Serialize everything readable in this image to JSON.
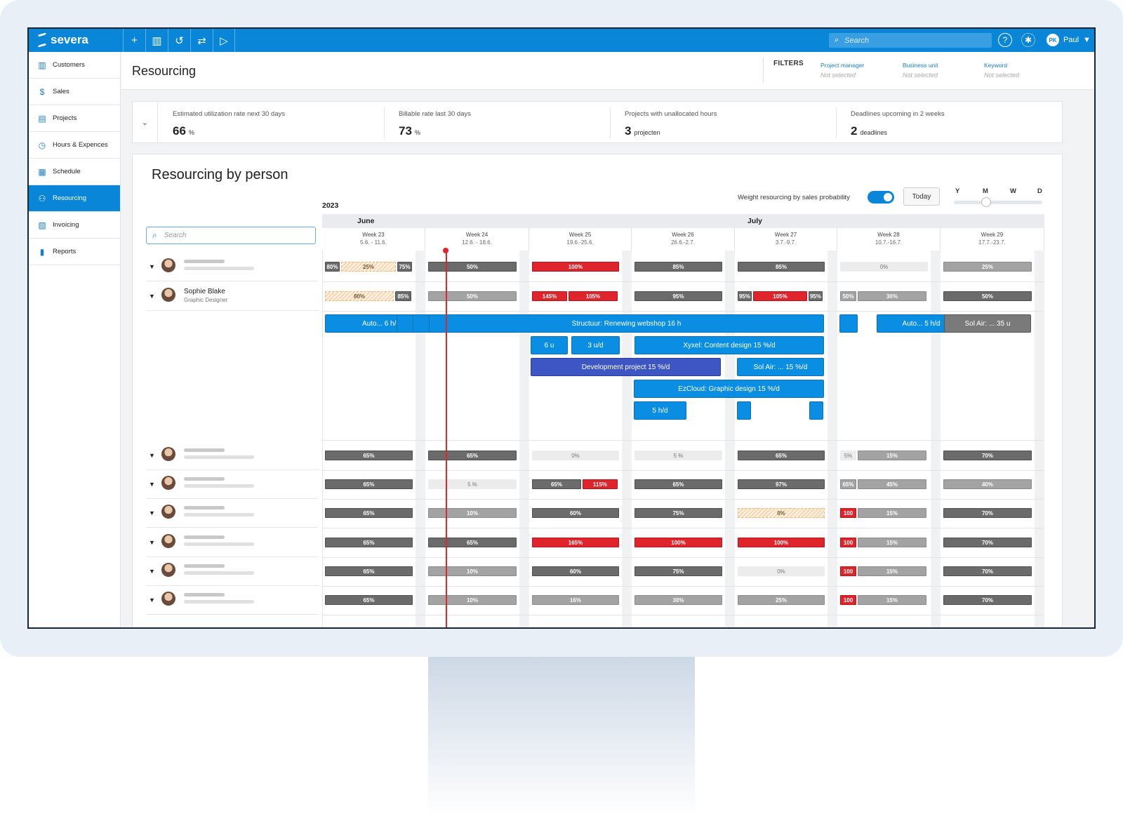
{
  "app": {
    "logo": "severa",
    "search_placeholder": "Search",
    "user_initials": "PK",
    "user_name": "Paul"
  },
  "toolbar_icons": [
    "plus-icon",
    "chart-icon",
    "history-icon",
    "swap-icon",
    "play-icon"
  ],
  "sidebar": {
    "items": [
      {
        "label": "Customers",
        "icon": "building-icon",
        "active": false
      },
      {
        "label": "Sales",
        "icon": "dollar-icon",
        "active": false
      },
      {
        "label": "Projects",
        "icon": "folder-icon",
        "active": false
      },
      {
        "label": "Hours & Expences",
        "icon": "clock-icon",
        "active": false
      },
      {
        "label": "Schedule",
        "icon": "calendar-icon",
        "active": false
      },
      {
        "label": "Resourcing",
        "icon": "people-icon",
        "active": true
      },
      {
        "label": "Invoicing",
        "icon": "invoice-icon",
        "active": false
      },
      {
        "label": "Reports",
        "icon": "bar-chart-icon",
        "active": false
      }
    ]
  },
  "header": {
    "title": "Resourcing",
    "filters_label": "FILTERS",
    "filters": [
      {
        "label": "Project manager",
        "value": "Not selected"
      },
      {
        "label": "Business unit",
        "value": "Not selected"
      },
      {
        "label": "Keyword",
        "value": "Not selected"
      }
    ]
  },
  "kpis": [
    {
      "label": "Estimated utilization rate next 30 days",
      "value": "66",
      "unit": "%"
    },
    {
      "label": "Billable rate last 30 days",
      "value": "73",
      "unit": "%"
    },
    {
      "label": "Projects with unallocated hours",
      "value": "3",
      "unit": "projecten"
    },
    {
      "label": "Deadlines upcoming in 2 weeks",
      "value": "2",
      "unit": "deadlines"
    }
  ],
  "section": {
    "title": "Resourcing by person",
    "weight_label": "Weight resourcing by sales probability",
    "weight_on": true,
    "today_label": "Today",
    "zoom_labels": [
      "Y",
      "M",
      "W",
      "D"
    ],
    "zoom_selected": "M",
    "year": "2023",
    "search_placeholder": "Search"
  },
  "months": [
    {
      "label": "June"
    },
    {
      "label": "July"
    }
  ],
  "weeks": [
    {
      "label": "Week 23",
      "dates": "5.6. - 11.6."
    },
    {
      "label": "Week 24",
      "dates": "12.6. - 18.6."
    },
    {
      "label": "Week 25",
      "dates": "19.6.-25.6."
    },
    {
      "label": "Week 26",
      "dates": "26.6.-2.7."
    },
    {
      "label": "Week 27",
      "dates": "3.7.-9.7."
    },
    {
      "label": "Week 28",
      "dates": "10.7.-16.7."
    },
    {
      "label": "Week 29",
      "dates": "17.7.-23.7."
    }
  ],
  "people": [
    {
      "name": "",
      "role": "",
      "placeholder": true,
      "weeks": [
        [
          [
            "80%",
            "dark",
            0.18
          ],
          [
            "25%",
            "striped",
            0.64
          ],
          [
            "75%",
            "dark",
            0.18
          ]
        ],
        [
          [
            "50%",
            "dark",
            1
          ]
        ],
        [
          [
            "100%",
            "red",
            1
          ]
        ],
        [
          [
            "85%",
            "dark",
            1
          ]
        ],
        [
          [
            "85%",
            "dark",
            1
          ]
        ],
        [
          [
            "0%",
            "empty",
            1
          ]
        ],
        [
          [
            "25%",
            "mid",
            1
          ]
        ]
      ]
    },
    {
      "name": "Sophie Blake",
      "role": "Graphic Designer",
      "placeholder": false,
      "weeks": [
        [
          [
            "80%",
            "striped",
            0.8
          ],
          [
            "85%",
            "dark",
            0.2
          ]
        ],
        [
          [
            "50%",
            "mid",
            1
          ]
        ],
        [
          [
            "145%",
            "red",
            0.42
          ],
          [
            "105%",
            "red",
            0.58
          ]
        ],
        [
          [
            "95%",
            "dark",
            1
          ]
        ],
        [
          [
            "95%",
            "dark",
            0.18
          ],
          [
            "105%",
            "red",
            0.64
          ],
          [
            "95%",
            "dark",
            0.18
          ]
        ],
        [
          [
            "50%",
            "mid",
            0.2
          ],
          [
            "30%",
            "mid",
            0.8
          ]
        ],
        [
          [
            "50%",
            "dark",
            1
          ]
        ]
      ]
    },
    {
      "name": "",
      "role": "",
      "placeholder": true,
      "weeks": [
        [
          [
            "65%",
            "dark",
            1
          ]
        ],
        [
          [
            "65%",
            "dark",
            1
          ]
        ],
        [
          [
            "0%",
            "empty",
            1
          ]
        ],
        [
          [
            "5 %",
            "empty",
            1
          ]
        ],
        [
          [
            "65%",
            "dark",
            1
          ]
        ],
        [
          [
            "5%",
            "empty",
            0.2
          ],
          [
            "15%",
            "mid",
            0.8
          ]
        ],
        [
          [
            "70%",
            "dark",
            1
          ]
        ]
      ]
    },
    {
      "name": "",
      "role": "",
      "placeholder": true,
      "weeks": [
        [
          [
            "65%",
            "dark",
            1
          ]
        ],
        [
          [
            "5 %",
            "empty",
            1
          ]
        ],
        [
          [
            "65%",
            "dark",
            0.58
          ],
          [
            "115%",
            "red",
            0.42
          ]
        ],
        [
          [
            "65%",
            "dark",
            1
          ]
        ],
        [
          [
            "97%",
            "dark",
            1
          ]
        ],
        [
          [
            "65%",
            "mid",
            0.2
          ],
          [
            "45%",
            "mid",
            0.8
          ]
        ],
        [
          [
            "40%",
            "mid",
            1
          ]
        ]
      ]
    },
    {
      "name": "",
      "role": "",
      "placeholder": true,
      "weeks": [
        [
          [
            "65%",
            "dark",
            1
          ]
        ],
        [
          [
            "10%",
            "mid",
            1
          ]
        ],
        [
          [
            "60%",
            "dark",
            1
          ]
        ],
        [
          [
            "75%",
            "dark",
            1
          ]
        ],
        [
          [
            "0%",
            "striped",
            1
          ]
        ],
        [
          [
            "100",
            "red",
            0.2
          ],
          [
            "15%",
            "mid",
            0.8
          ]
        ],
        [
          [
            "70%",
            "dark",
            1
          ]
        ]
      ]
    },
    {
      "name": "",
      "role": "",
      "placeholder": true,
      "weeks": [
        [
          [
            "65%",
            "dark",
            1
          ]
        ],
        [
          [
            "65%",
            "dark",
            1
          ]
        ],
        [
          [
            "165%",
            "red",
            1
          ]
        ],
        [
          [
            "100%",
            "red",
            1
          ]
        ],
        [
          [
            "100%",
            "red",
            1
          ]
        ],
        [
          [
            "100",
            "red",
            0.2
          ],
          [
            "15%",
            "mid",
            0.8
          ]
        ],
        [
          [
            "70%",
            "dark",
            1
          ]
        ]
      ]
    },
    {
      "name": "",
      "role": "",
      "placeholder": true,
      "weeks": [
        [
          [
            "65%",
            "dark",
            1
          ]
        ],
        [
          [
            "10%",
            "mid",
            1
          ]
        ],
        [
          [
            "60%",
            "dark",
            1
          ]
        ],
        [
          [
            "75%",
            "dark",
            1
          ]
        ],
        [
          [
            "0%",
            "empty",
            1
          ]
        ],
        [
          [
            "100",
            "red",
            0.2
          ],
          [
            "15%",
            "mid",
            0.8
          ]
        ],
        [
          [
            "70%",
            "dark",
            1
          ]
        ]
      ]
    },
    {
      "name": "",
      "role": "",
      "placeholder": true,
      "weeks": [
        [
          [
            "65%",
            "dark",
            1
          ]
        ],
        [
          [
            "10%",
            "mid",
            1
          ]
        ],
        [
          [
            "16%",
            "mid",
            1
          ]
        ],
        [
          [
            "30%",
            "mid",
            1
          ]
        ],
        [
          [
            "25%",
            "mid",
            1
          ]
        ],
        [
          [
            "100",
            "red",
            0.2
          ],
          [
            "15%",
            "mid",
            0.8
          ]
        ],
        [
          [
            "70%",
            "dark",
            1
          ]
        ]
      ]
    }
  ],
  "tasks": [
    {
      "label": "Auto... 6 h/d",
      "style": "blue"
    },
    {
      "label": "",
      "style": "blue"
    },
    {
      "label": "Structuur: Renewing webshop  16 h",
      "style": "blue"
    },
    {
      "label": "",
      "style": "blue"
    },
    {
      "label": "Auto... 5 h/d",
      "style": "blue"
    },
    {
      "label": "Sol Air: ... 35 u",
      "style": "gray"
    },
    {
      "label": "6 u",
      "style": "blue"
    },
    {
      "label": "3 u/d",
      "style": "blue"
    },
    {
      "label": "Xyxel: Content design 15 %/d",
      "style": "blue"
    },
    {
      "label": "Development project 15 %/d",
      "style": "indigo"
    },
    {
      "label": "Sol Air: ... 15 %/d",
      "style": "blue"
    },
    {
      "label": "EzCloud: Graphic design 15 %/d",
      "style": "blue"
    },
    {
      "label": "5 h/d",
      "style": "blue"
    },
    {
      "label": "",
      "style": "blue"
    },
    {
      "label": "",
      "style": "blue"
    }
  ]
}
